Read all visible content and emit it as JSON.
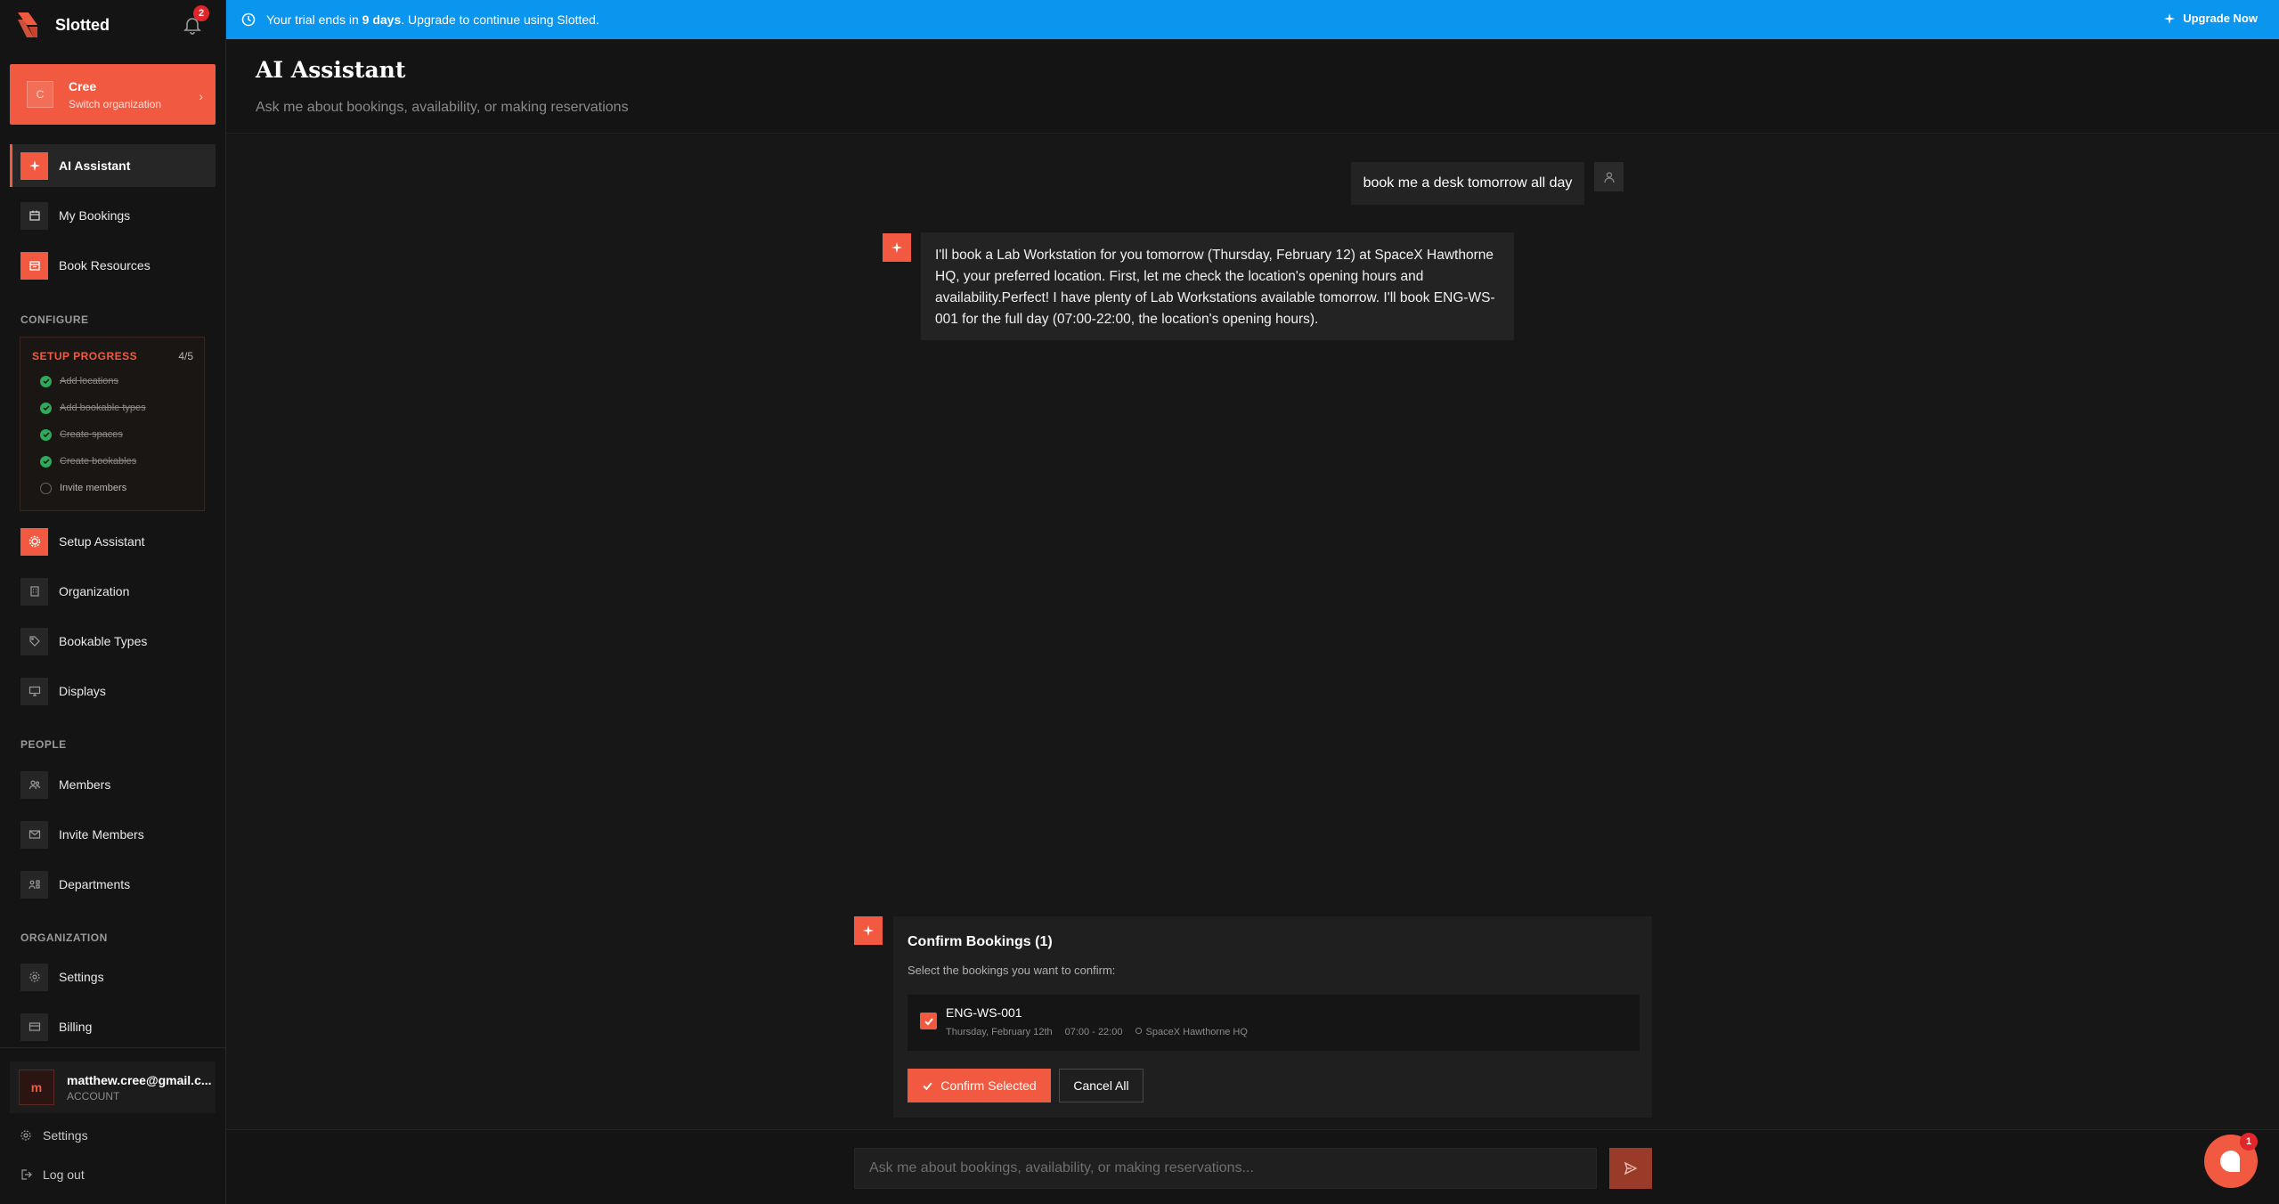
{
  "app": {
    "name": "Slotted",
    "notification_count": "2"
  },
  "org": {
    "initial": "C",
    "name": "Cree",
    "subtitle": "Switch organization"
  },
  "nav_top": [
    {
      "label": "AI Assistant",
      "icon": "sparkle-icon",
      "active": true
    },
    {
      "label": "My Bookings",
      "icon": "calendar-icon"
    },
    {
      "label": "Book Resources",
      "icon": "calendar-plus-icon"
    }
  ],
  "sections": {
    "configure": "CONFIGURE",
    "people": "PEOPLE",
    "organization": "ORGANIZATION"
  },
  "setup": {
    "title": "SETUP PROGRESS",
    "count": "4/5",
    "steps": [
      {
        "label": "Add locations",
        "done": true
      },
      {
        "label": "Add bookable types",
        "done": true
      },
      {
        "label": "Create spaces",
        "done": true
      },
      {
        "label": "Create bookables",
        "done": true
      },
      {
        "label": "Invite members",
        "done": false
      }
    ]
  },
  "nav_configure": [
    {
      "label": "Setup Assistant",
      "icon": "cog-orange-icon"
    },
    {
      "label": "Organization",
      "icon": "building-icon"
    },
    {
      "label": "Bookable Types",
      "icon": "tag-icon"
    },
    {
      "label": "Displays",
      "icon": "monitor-icon"
    }
  ],
  "nav_people": [
    {
      "label": "Members",
      "icon": "users-icon"
    },
    {
      "label": "Invite Members",
      "icon": "mail-icon"
    },
    {
      "label": "Departments",
      "icon": "departments-icon"
    }
  ],
  "nav_org": [
    {
      "label": "Settings",
      "icon": "gear-icon"
    },
    {
      "label": "Billing",
      "icon": "credit-card-icon"
    }
  ],
  "account": {
    "initial": "m",
    "email": "matthew.cree@gmail.c...",
    "role": "ACCOUNT"
  },
  "footer": {
    "settings": "Settings",
    "logout": "Log out"
  },
  "banner": {
    "text_prefix": "Your trial ends in ",
    "text_days": "9 days",
    "text_suffix": ". Upgrade to continue using Slotted.",
    "upgrade": "Upgrade Now"
  },
  "header": {
    "title": "AI Assistant",
    "subtitle": "Ask me about bookings, availability, or making reservations"
  },
  "messages": {
    "user": "book me a desk tomorrow all day",
    "assistant": "I'll book a Lab Workstation for you tomorrow (Thursday, February 12) at SpaceX Hawthorne HQ, your preferred location. First, let me check the location's opening hours and availability.Perfect! I have plenty of Lab Workstations available tomorrow. I'll book ENG-WS-001 for the full day (07:00-22:00, the location's opening hours)."
  },
  "confirm": {
    "title": "Confirm Bookings (1)",
    "subtitle": "Select the bookings you want to confirm:",
    "booking": {
      "name": "ENG-WS-001",
      "date": "Thursday, February 12th",
      "time": "07:00 - 22:00",
      "location": "SpaceX Hawthorne HQ",
      "checked": true
    },
    "confirm_label": "Confirm Selected",
    "cancel_label": "Cancel All"
  },
  "composer": {
    "placeholder": "Ask me about bookings, availability, or making reservations..."
  },
  "help": {
    "badge": "1"
  },
  "colors": {
    "accent": "#f15a40",
    "banner": "#0a95ee",
    "background": "#141414",
    "success": "#2faa5a"
  }
}
